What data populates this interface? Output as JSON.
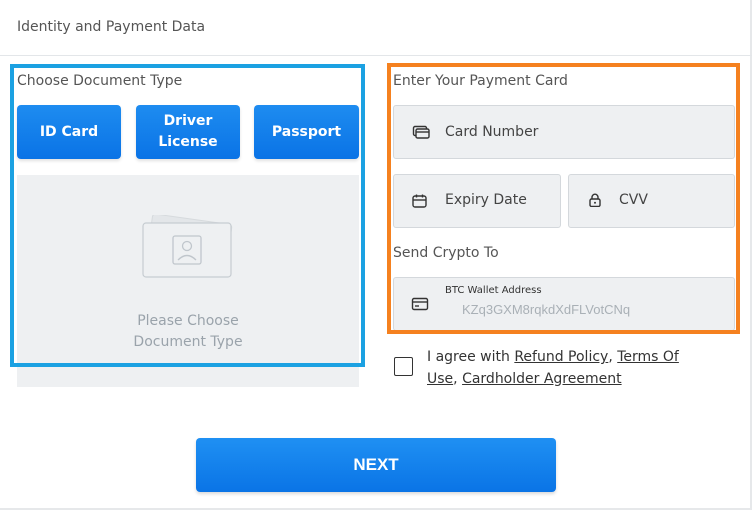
{
  "header": {
    "title": "Identity and Payment Data"
  },
  "document": {
    "section_label": "Choose Document Type",
    "buttons": [
      {
        "label": "ID Card"
      },
      {
        "label": "Driver\nLicense"
      },
      {
        "label": "Passport"
      }
    ],
    "placeholder": "Please Choose\nDocument Type"
  },
  "payment": {
    "section_label": "Enter Your Payment Card",
    "card_number": {
      "placeholder": "Card Number",
      "icon": "credit-card-icon"
    },
    "expiry": {
      "placeholder": "Expiry Date",
      "icon": "calendar-icon"
    },
    "cvv": {
      "placeholder": "CVV",
      "icon": "lock-icon"
    }
  },
  "crypto": {
    "section_label": "Send Crypto To",
    "field_caption": "BTC Wallet Address",
    "value": "KZq3GXM8rqkdXdFLVotCNq",
    "icon": "wallet-icon"
  },
  "agreement": {
    "prefix": "I agree with ",
    "refund_policy": "Refund Policy",
    "separator1": ", ",
    "terms_of_use": "Terms Of Use",
    "separator2": ", ",
    "cardholder_agreement": "Cardholder Agreement",
    "checked": false
  },
  "next_button": {
    "label": "NEXT"
  },
  "colors": {
    "primary": "#0a73e6",
    "highlight_left": "#1ba1e2",
    "highlight_right": "#f5811f"
  }
}
